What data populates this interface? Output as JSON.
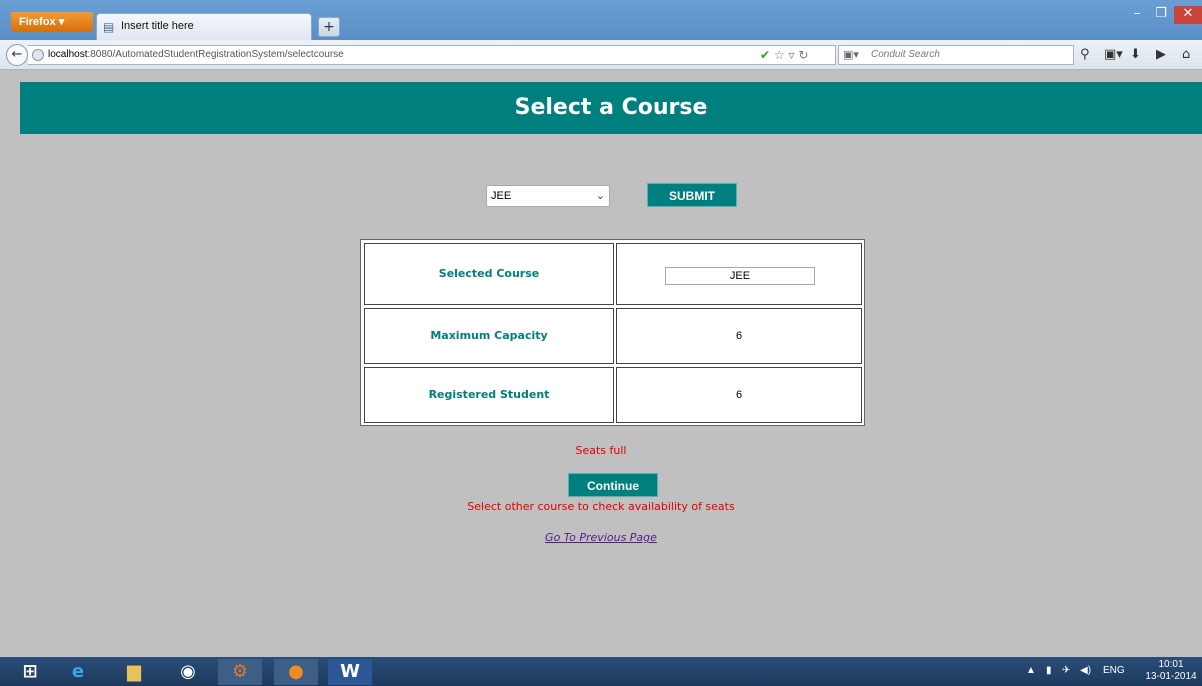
{
  "browser": {
    "menu_button": "Firefox",
    "tab_title": "Insert title here",
    "new_tab": "+",
    "url_host": "localhost",
    "url_rest": ":8080/AutomatedStudentRegistrationSystem/selectcourse",
    "search_placeholder": "Conduit Search",
    "win_min": "–",
    "win_max": "❐",
    "win_close": "✕"
  },
  "page": {
    "title": "Select a Course",
    "select_value": "JEE",
    "submit_label": "SUBMIT",
    "table": {
      "rows": [
        {
          "label": "Selected Course",
          "value": "JEE"
        },
        {
          "label": "Maximum Capacity",
          "value": "6"
        },
        {
          "label": "Registered Student",
          "value": "6"
        }
      ]
    },
    "status_message": "Seats full",
    "continue_label": "Continue",
    "hint_message": "Select other course to check availability of seats",
    "previous_link": "Go To Previous Page"
  },
  "taskbar": {
    "language": "ENG",
    "time": "10:01",
    "date": "13-01-2014"
  },
  "colors": {
    "accent": "#007f7f",
    "error": "#e00000",
    "background": "#c0c0c0"
  }
}
